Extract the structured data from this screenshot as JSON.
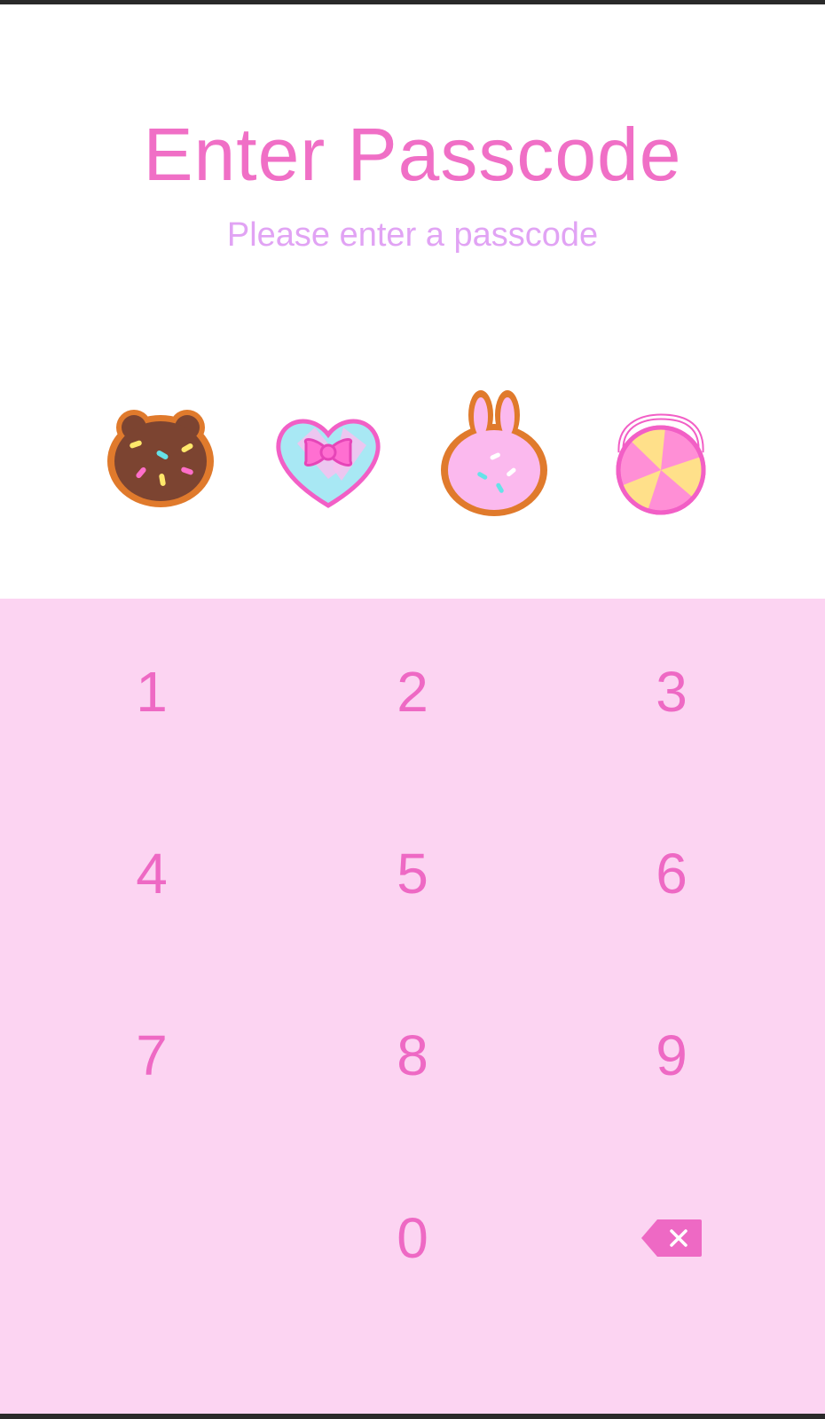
{
  "header": {
    "title": "Enter Passcode",
    "subtitle": "Please enter a passcode"
  },
  "indicators": [
    {
      "icon": "bear-donut-icon"
    },
    {
      "icon": "heart-bow-candy-icon"
    },
    {
      "icon": "bunny-cookie-icon"
    },
    {
      "icon": "lollipop-candy-icon"
    }
  ],
  "keypad": {
    "keys": [
      "1",
      "2",
      "3",
      "4",
      "5",
      "6",
      "7",
      "8",
      "9",
      "0"
    ],
    "backspace_icon": "backspace-icon"
  },
  "colors": {
    "accent": "#ee69c4",
    "subtitle": "#e1a3f4",
    "keypad_background": "#fcd4f2"
  }
}
